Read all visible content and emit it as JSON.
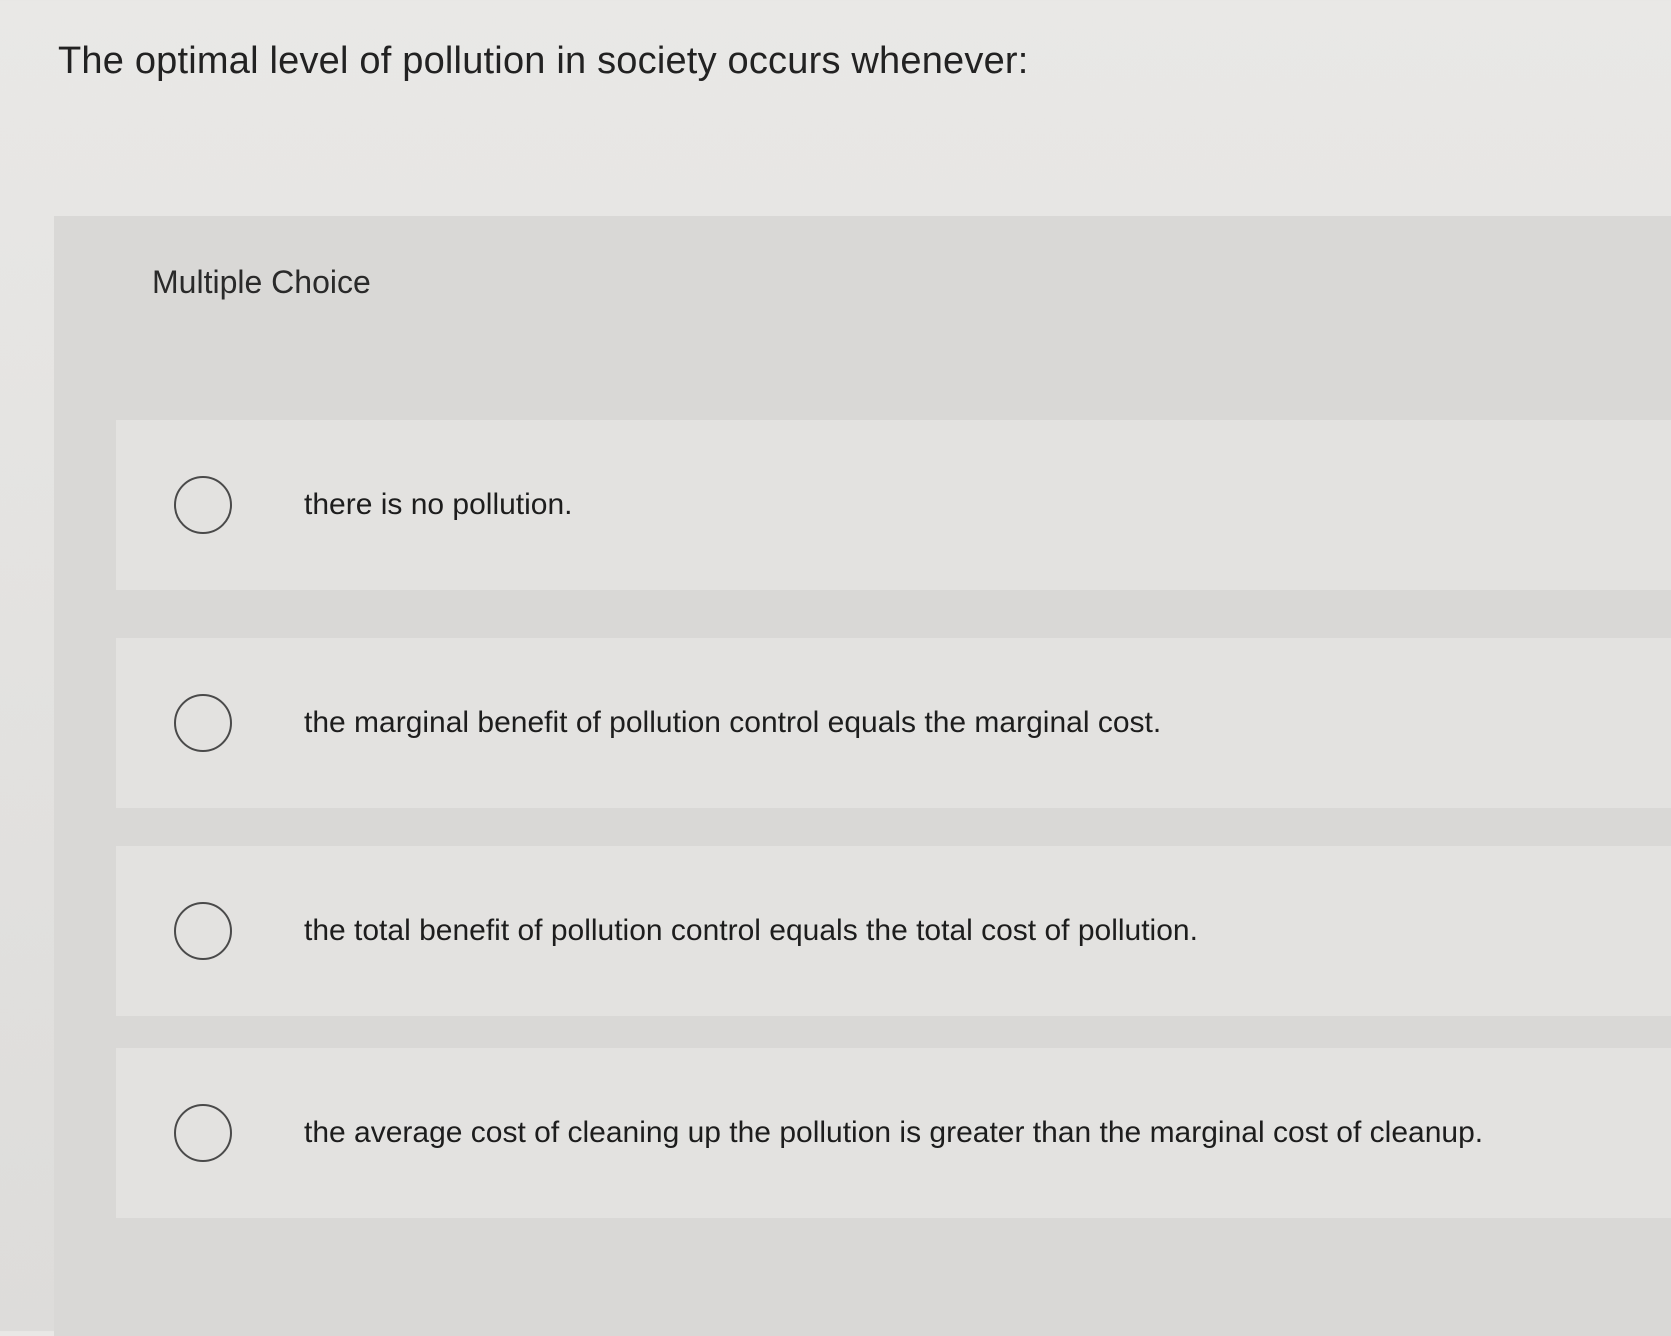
{
  "question": {
    "text": "The optimal level of pollution in society occurs whenever:"
  },
  "panel": {
    "label": "Multiple Choice"
  },
  "options": [
    {
      "text": "there is no pollution.",
      "selected": false
    },
    {
      "text": "the marginal benefit of pollution control equals the marginal cost.",
      "selected": false
    },
    {
      "text": "the total benefit of pollution control equals the total cost of pollution.",
      "selected": false
    },
    {
      "text": "the average cost of cleaning up the pollution is greater than the marginal cost of cleanup.",
      "selected": false
    }
  ],
  "icons": {
    "radio": "radio-circle-icon"
  }
}
